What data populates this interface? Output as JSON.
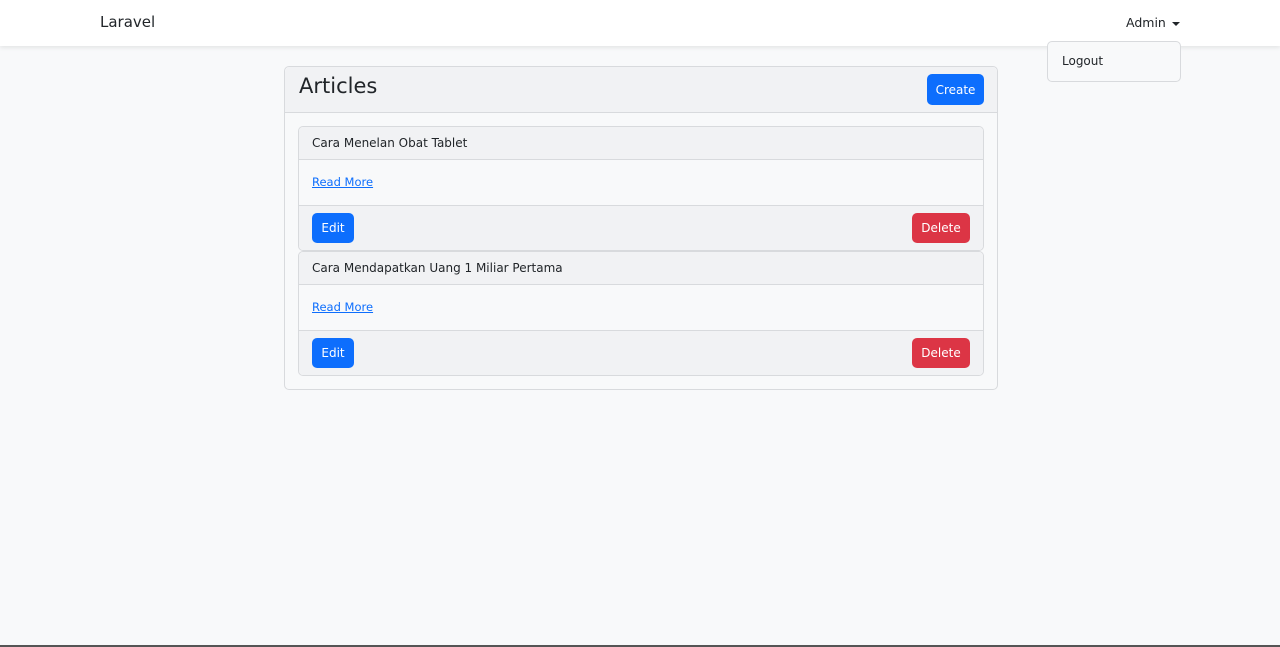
{
  "navbar": {
    "brand": "Laravel",
    "user": "Admin",
    "dropdown": [
      "Logout"
    ]
  },
  "page": {
    "title": "Articles",
    "create_label": "Create"
  },
  "articles": [
    {
      "title": "Cara Menelan Obat Tablet",
      "link": "Read More",
      "edit": "Edit",
      "delete": "Delete"
    },
    {
      "title": "Cara Mendapatkan Uang 1 Miliar Pertama",
      "link": "Read More",
      "edit": "Edit",
      "delete": "Delete"
    }
  ],
  "colors": {
    "primary": "#0d6efd",
    "danger": "#dc3545"
  }
}
